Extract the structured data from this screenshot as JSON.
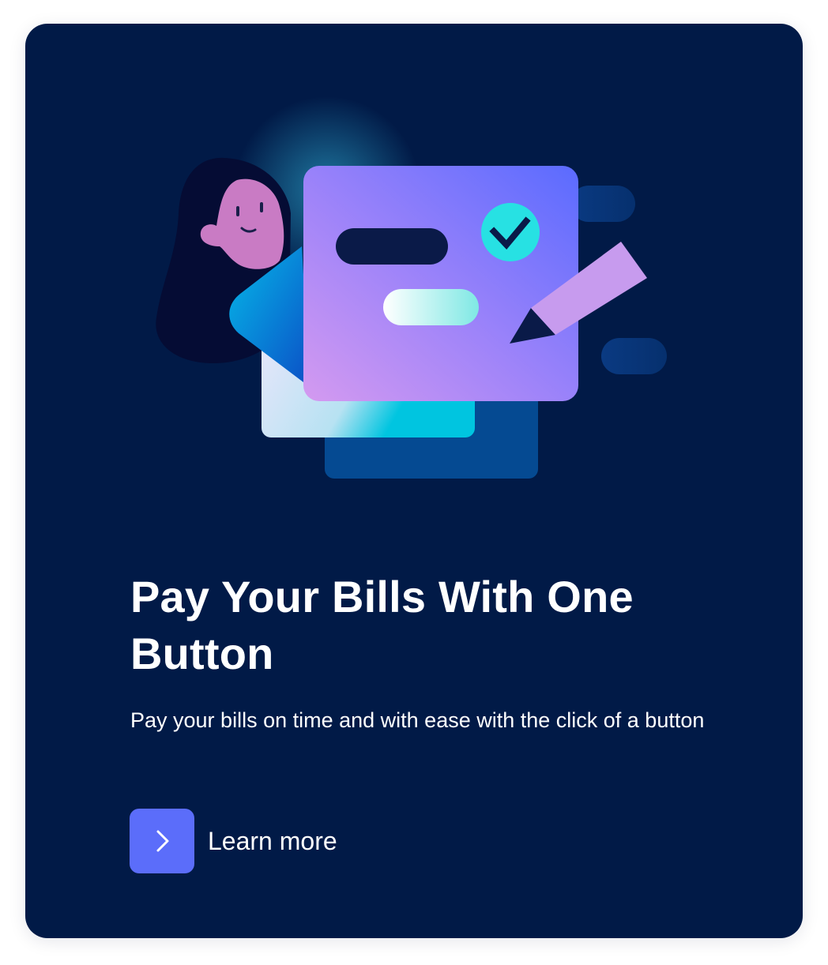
{
  "card": {
    "title": "Pay Your Bills With One Button",
    "description": "Pay your bills on time and with ease with the click of a button",
    "cta": {
      "label": "Learn more",
      "icon": "chevron-right-icon"
    },
    "illustration": {
      "icon": "bill-payment-illustration"
    }
  },
  "colors": {
    "card_background": "#011a47",
    "accent": "#5b6dfa",
    "text": "#ffffff"
  }
}
